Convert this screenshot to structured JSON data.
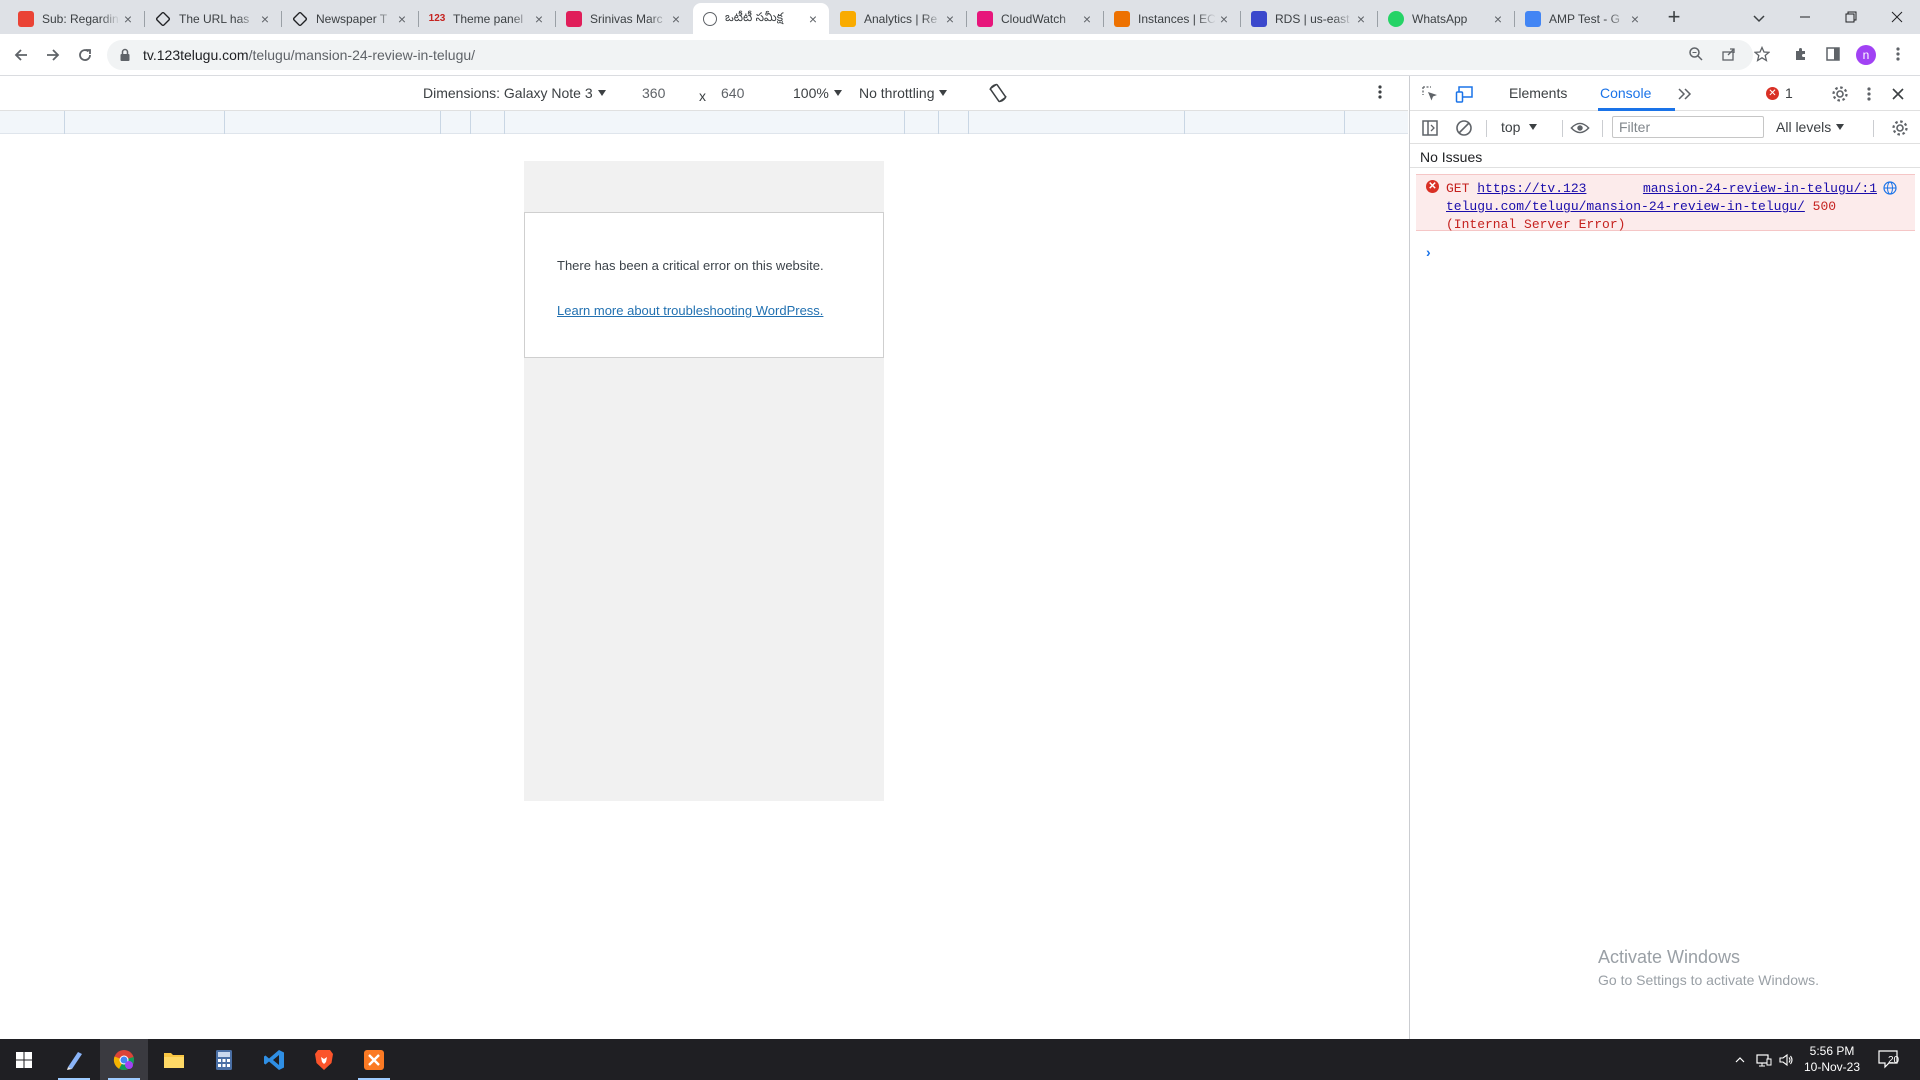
{
  "tabs": [
    {
      "title": "Sub: Regarding",
      "icon": "gmail-icon",
      "color": "#ea4335",
      "active": false
    },
    {
      "title": "The URL has",
      "icon": "ampproject-icon",
      "color": "#202124",
      "active": false
    },
    {
      "title": "Newspaper T",
      "icon": "ampproject-icon",
      "color": "#202124",
      "active": false
    },
    {
      "title": "Theme panel",
      "icon": "123-icon",
      "color": "#c5221f",
      "active": false,
      "glyph": "123"
    },
    {
      "title": "Srinivas Marc",
      "icon": "slack-icon",
      "color": "#e01e5a",
      "active": false
    },
    {
      "title": "ఒటీటీ సమీక్ష",
      "icon": "globe-icon",
      "color": "#5f6368",
      "active": true
    },
    {
      "title": "Analytics | Re",
      "icon": "analytics-icon",
      "color": "#f9ab00",
      "active": false
    },
    {
      "title": "CloudWatch",
      "icon": "cloudwatch-icon",
      "color": "#e7157b",
      "active": false
    },
    {
      "title": "Instances | EC",
      "icon": "ec2-icon",
      "color": "#ed7100",
      "active": false
    },
    {
      "title": "RDS | us-east",
      "icon": "rds-icon",
      "color": "#3b48cc",
      "active": false
    },
    {
      "title": "WhatsApp",
      "icon": "whatsapp-icon",
      "color": "#25d366",
      "active": false
    },
    {
      "title": "AMP Test - G",
      "icon": "amp-test-icon",
      "color": "#4285f4",
      "active": false
    }
  ],
  "address": {
    "host": "tv.123telugu.com",
    "path": "/telugu/mansion-24-review-in-telugu/"
  },
  "device_toolbar": {
    "dimensions": "Dimensions: Galaxy Note 3",
    "width": "360",
    "times": "x",
    "height": "640",
    "zoom": "100%",
    "throttling": "No throttling"
  },
  "page": {
    "error_text": "There has been a critical error on this website.",
    "link_text": "Learn more about troubleshooting WordPress."
  },
  "devtools": {
    "tabs": [
      "Elements",
      "Console"
    ],
    "active_tab": "Console",
    "error_count": "1",
    "context": "top",
    "filter_placeholder": "Filter",
    "levels": "All levels",
    "issues": "No Issues",
    "message": {
      "method": "GET",
      "url_part1": "https://tv.123",
      "url_part2": "telugu.com/telugu/mansion-24-review-in-telugu/",
      "status": "500",
      "status_text": "(Internal Server Error)",
      "source": "mansion-24-review-in-telugu/:1"
    },
    "prompt": "›"
  },
  "watermark": {
    "line1": "Activate Windows",
    "line2": "Go to Settings to activate Windows."
  },
  "taskbar": {
    "time": "5:56 PM",
    "date": "10-Nov-23",
    "notifications": "20"
  },
  "colors": {
    "accent": "#1a73e8",
    "error": "#d93025",
    "wp_link": "#2271b1"
  }
}
